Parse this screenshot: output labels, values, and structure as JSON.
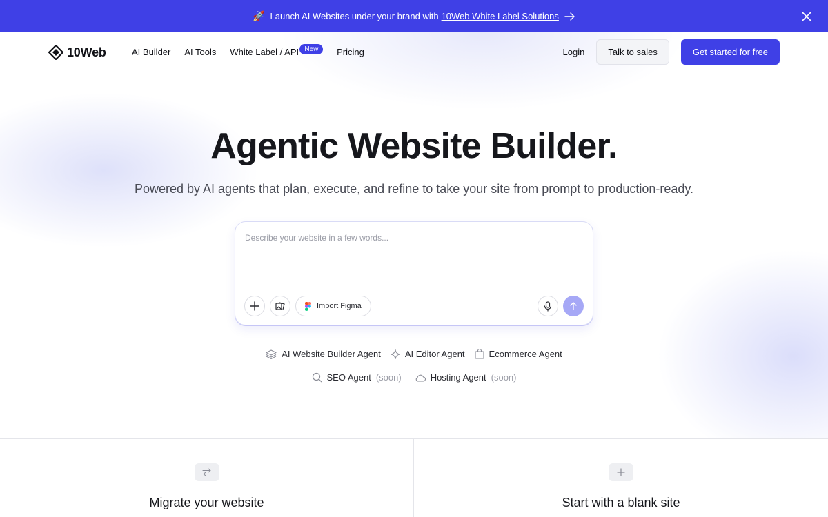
{
  "banner": {
    "rocket_emoji": "🚀",
    "text": "Launch AI Websites under your brand with",
    "link_text": "10Web White Label Solutions",
    "bg_color": "#3f40e6"
  },
  "nav": {
    "brand": "10Web",
    "links": [
      "AI Builder",
      "AI Tools",
      "White Label / API",
      "Pricing"
    ],
    "badge": "New",
    "login": "Login",
    "talk_to_sales": "Talk to sales",
    "get_started": "Get started for free"
  },
  "hero": {
    "headline": "Agentic Website Builder.",
    "subhead": "Powered by AI agents that plan, execute, and refine to take your site from prompt to production-ready."
  },
  "prompt": {
    "placeholder": "Describe your website in a few words...",
    "import_figma": "Import Figma"
  },
  "agents": {
    "row1": [
      "AI Website Builder Agent",
      "AI Editor Agent",
      "Ecommerce Agent"
    ],
    "row2": [
      {
        "name": "SEO Agent",
        "tag": "(soon)"
      },
      {
        "name": "Hosting Agent",
        "tag": "(soon)"
      }
    ]
  },
  "cards": {
    "migrate": "Migrate your website",
    "blank": "Start with a blank site"
  },
  "icons": [
    "rocket",
    "arrow-right-icon",
    "close-icon",
    "logo-icon",
    "plus-icon",
    "image-icon",
    "figma-icon",
    "mic-icon",
    "send-icon",
    "layers-icon",
    "sparkle-icon",
    "bag-icon",
    "search-icon",
    "cloud-icon",
    "swap-icon"
  ],
  "colors": {
    "accent": "#3f40e6",
    "send_disabled": "#a6a8f6"
  }
}
